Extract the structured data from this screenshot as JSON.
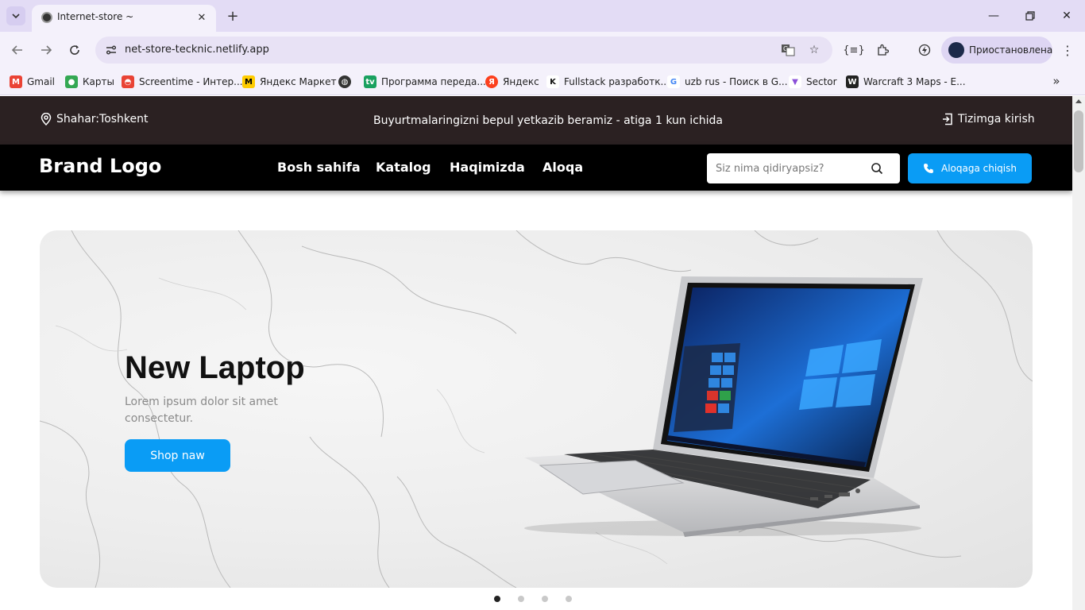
{
  "browser": {
    "tab_title": "Internet-store ~",
    "url": "net-store-tecknic.netlify.app",
    "profile_label": "Приостановлена",
    "bookmarks": [
      {
        "label": "Gmail",
        "icon": "gmail-icon",
        "color": "#ea4335"
      },
      {
        "label": "Карты",
        "icon": "maps-icon",
        "color": "#34a853"
      },
      {
        "label": "Screentime - Интер...",
        "icon": "screentime-icon",
        "color": "#e94335"
      },
      {
        "label": "Яндекс Маркет",
        "icon": "yandex-market-icon",
        "color": "#ffcc00"
      },
      {
        "label": "",
        "icon": "globe-icon",
        "color": "#333333"
      },
      {
        "label": "Программа переда...",
        "icon": "tv-program-icon",
        "color": "#1aa160"
      },
      {
        "label": "Яндекс",
        "icon": "yandex-icon",
        "color": "#fc3f1d"
      },
      {
        "label": "Fullstack разработк...",
        "icon": "k-logo-icon",
        "color": "#111111"
      },
      {
        "label": "uzb rus - Поиск в G...",
        "icon": "google-icon",
        "color": "#4285f4"
      },
      {
        "label": "Sector",
        "icon": "sector-icon",
        "color": "#8a4fd8"
      },
      {
        "label": "Warcraft 3 Maps - E...",
        "icon": "warcraft-icon",
        "color": "#222222"
      }
    ]
  },
  "site": {
    "topbar": {
      "city": "Shahar:Toshkent",
      "promo": "Buyurtmalaringizni bepul yetkazib beramiz - atiga 1 kun ichida",
      "login": "Tizimga kirish"
    },
    "nav": {
      "brand": "Brand Logo",
      "links": [
        "Bosh sahifa",
        "Katalog",
        "Haqimizda",
        "Aloqa"
      ],
      "search_placeholder": "Siz nima qidiryapsiz?",
      "contact_button": "Aloqaga chiqish"
    },
    "hero": {
      "title": "New Laptop",
      "subtitle": "Lorem ipsum dolor sit amet consectetur.",
      "button": "Shop naw",
      "slides_count": 4,
      "active_slide": 1
    }
  },
  "colors": {
    "topbar_bg": "#2b2122",
    "nav_bg": "#000000",
    "accent": "#0a9cf5"
  }
}
